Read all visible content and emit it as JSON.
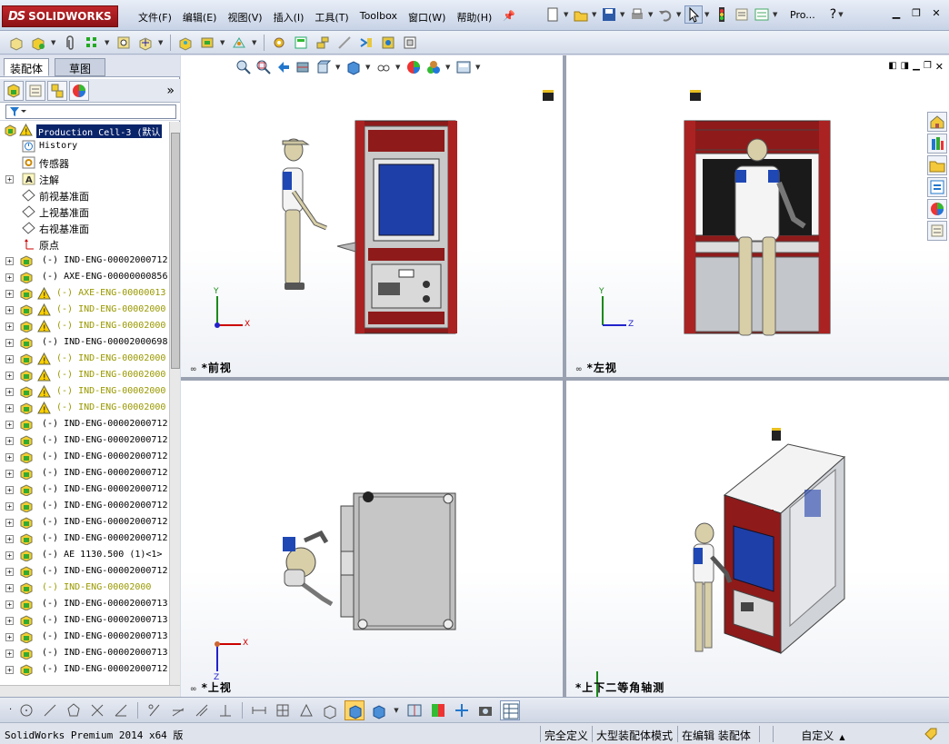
{
  "app": {
    "title": "SolidWorks Premium 2014 x64 版",
    "logo": "SOLIDWORKS",
    "logo_ds": "DS"
  },
  "menu": [
    "文件(F)",
    "编辑(E)",
    "视图(V)",
    "插入(I)",
    "工具(T)",
    "Toolbox",
    "窗口(W)",
    "帮助(H)"
  ],
  "search_label": "Pro...",
  "tabs": {
    "assembly": "装配体",
    "sketch": "草图"
  },
  "tree": {
    "root": "Production Cell-3 (默认",
    "history": "History",
    "sensors": "传感器",
    "annotations": "注解",
    "front_plane": "前视基准面",
    "top_plane": "上视基准面",
    "right_plane": "右视基准面",
    "origin": "原点",
    "items": [
      {
        "text": "(-) IND-ENG-00002000712",
        "warn": false,
        "yellow": false
      },
      {
        "text": "(-) AXE-ENG-00000000856",
        "warn": false,
        "yellow": false
      },
      {
        "text": "(-) AXE-ENG-00000013",
        "warn": true,
        "yellow": true
      },
      {
        "text": "(-) IND-ENG-00002000",
        "warn": true,
        "yellow": true
      },
      {
        "text": "(-) IND-ENG-00002000",
        "warn": true,
        "yellow": true
      },
      {
        "text": "(-) IND-ENG-00002000698",
        "warn": false,
        "yellow": false
      },
      {
        "text": "(-) IND-ENG-00002000",
        "warn": true,
        "yellow": true
      },
      {
        "text": "(-) IND-ENG-00002000",
        "warn": true,
        "yellow": true
      },
      {
        "text": "(-) IND-ENG-00002000",
        "warn": true,
        "yellow": true
      },
      {
        "text": "(-) IND-ENG-00002000",
        "warn": true,
        "yellow": true
      },
      {
        "text": "(-) IND-ENG-00002000712",
        "warn": false,
        "yellow": false
      },
      {
        "text": "(-) IND-ENG-00002000712",
        "warn": false,
        "yellow": false
      },
      {
        "text": "(-) IND-ENG-00002000712",
        "warn": false,
        "yellow": false
      },
      {
        "text": "(-) IND-ENG-00002000712",
        "warn": false,
        "yellow": false
      },
      {
        "text": "(-) IND-ENG-00002000712",
        "warn": false,
        "yellow": false
      },
      {
        "text": "(-) IND-ENG-00002000712",
        "warn": false,
        "yellow": false
      },
      {
        "text": "(-) IND-ENG-00002000712",
        "warn": false,
        "yellow": false
      },
      {
        "text": "(-) IND-ENG-00002000712",
        "warn": false,
        "yellow": false
      },
      {
        "text": "(-) AE 1130.500 (1)<1>",
        "warn": false,
        "yellow": false
      },
      {
        "text": "(-) IND-ENG-00002000712",
        "warn": false,
        "yellow": false
      },
      {
        "text": "(-) IND-ENG-00002000",
        "warn": false,
        "yellow": true
      },
      {
        "text": "(-) IND-ENG-00002000713",
        "warn": false,
        "yellow": false
      },
      {
        "text": "(-) IND-ENG-00002000713",
        "warn": false,
        "yellow": false
      },
      {
        "text": "(-) IND-ENG-00002000713",
        "warn": false,
        "yellow": false
      },
      {
        "text": "(-) IND-ENG-00002000713",
        "warn": false,
        "yellow": false
      },
      {
        "text": "(-) IND-ENG-00002000712",
        "warn": false,
        "yellow": false
      }
    ]
  },
  "views": {
    "front": "*前视",
    "left": "*左视",
    "top": "*上视",
    "iso": "*上下二等角轴测"
  },
  "axes": {
    "x": "X",
    "y": "Y",
    "z": "Z"
  },
  "status": {
    "left": "SolidWorks Premium 2014 x64 版",
    "fully_defined": "完全定义",
    "large_asm": "大型装配体模式",
    "editing": "在编辑 装配体",
    "custom": "自定义"
  },
  "colors": {
    "frame_red": "#8f1a1a",
    "screen_blue": "#1f3fa8",
    "panel_grey": "#b9bcc2",
    "accent": "#cc2222"
  }
}
